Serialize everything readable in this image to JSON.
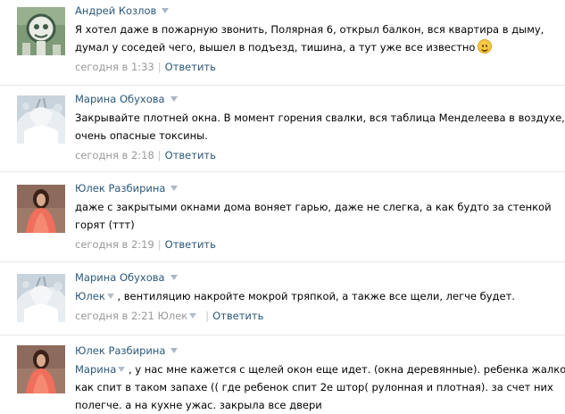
{
  "comments": [
    {
      "author": "Андрей Козлов",
      "lines": [
        "Я хотел даже в пожарную звонить, Полярная 6, открыл балкон, вся квартира в дыму,",
        "думал у соседей чего, вышел в подъезд, тишина, а тут уже все известно"
      ],
      "emoji": "smile-emoji-icon",
      "time": "сегодня в 1:33",
      "reply": "Ответить"
    },
    {
      "author": "Марина Обухова",
      "lines": [
        "Закрывайте плотней окна. В момент горения свалки, вся таблица Менделеева в воздухе,",
        "очень опасные токсины."
      ],
      "time": "сегодня в 2:18",
      "reply": "Ответить"
    },
    {
      "author": "Юлек Разбирина",
      "lines": [
        "даже с закрытыми окнами дома воняет гарью, даже не слегка, а как будто за стенкой",
        "горят (ттт)"
      ],
      "time": "сегодня в 2:19",
      "reply": "Ответить"
    },
    {
      "author": "Марина Обухова",
      "mention": "Юлек",
      "lines": [
        ", вентиляцию накройте мокрой тряпкой, а также все щели, легче будет."
      ],
      "time": "сегодня в 2:21",
      "reply_to": "Юлек",
      "reply": "Ответить"
    },
    {
      "author": "Юлек Разбирина",
      "mention": "Марина",
      "lines": [
        ", у нас мне кажется с щелей окон еще идет. (окна деревянные). ребенка жалко,",
        "как спит в таком запахе (( где ребенок спит 2е штор( рулонная и плотная). за счет них",
        "полегче. а на кухне ужас. закрыла все двери"
      ]
    }
  ]
}
